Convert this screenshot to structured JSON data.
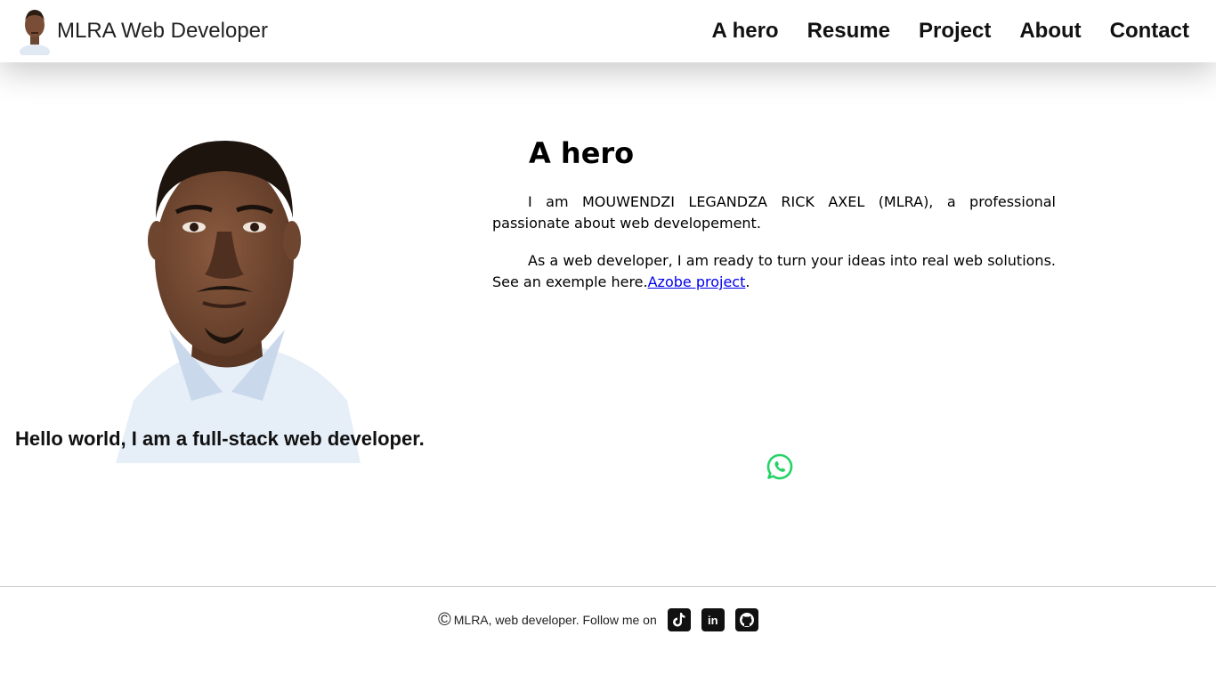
{
  "header": {
    "brand_title": "MLRA Web Developer",
    "nav": [
      {
        "label": "A hero"
      },
      {
        "label": "Resume"
      },
      {
        "label": "Project"
      },
      {
        "label": "About"
      },
      {
        "label": "Contact"
      }
    ]
  },
  "hero": {
    "tagline": "Hello world, I am a full-stack web developer.",
    "heading": "A hero",
    "para1": "I am MOUWENDZI LEGANDZA RICK AXEL (MLRA), a professional passionate about web developement.",
    "para2_text": "As a web developer, I am ready to turn your ideas into real web solutions. See an exemple here.",
    "para2_link": "Azobe project",
    "para2_end": "."
  },
  "footer": {
    "copyright_symbol": "©",
    "text": "MLRA, web developer. Follow me on",
    "socials": [
      {
        "icon": "tiktok-icon"
      },
      {
        "icon": "linkedin-icon",
        "label": "in"
      },
      {
        "icon": "github-icon"
      }
    ]
  },
  "colors": {
    "link": "#0000ee",
    "whatsapp": "#25d366",
    "social_bg": "#111111"
  }
}
